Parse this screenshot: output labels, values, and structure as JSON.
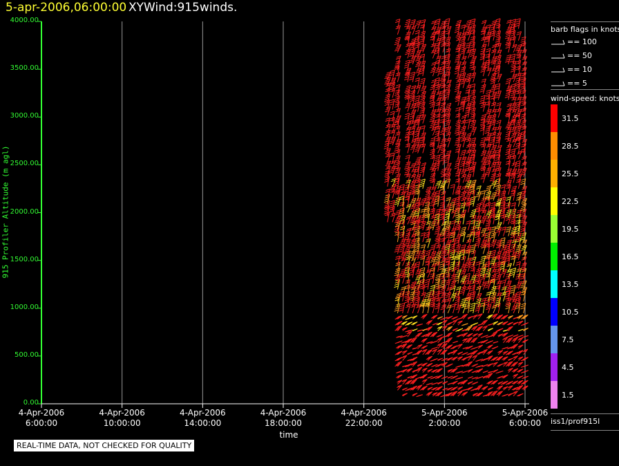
{
  "header": {
    "datetime": "5-apr-2006,06:00:00",
    "plot_name": "XYWind:915winds."
  },
  "chart_data": {
    "type": "scatter",
    "subtype": "wind-barbs",
    "xlabel": "time",
    "ylabel": "915 Profiler Altitude (m agl)",
    "ylim": [
      0,
      4000
    ],
    "x_ticks": [
      {
        "line1": "4-Apr-2006",
        "line2": "6:00:00"
      },
      {
        "line1": "4-Apr-2006",
        "line2": "10:00:00"
      },
      {
        "line1": "4-Apr-2006",
        "line2": "14:00:00"
      },
      {
        "line1": "4-Apr-2006",
        "line2": "18:00:00"
      },
      {
        "line1": "4-Apr-2006",
        "line2": "22:00:00"
      },
      {
        "line1": "5-Apr-2006",
        "line2": "2:00:00"
      },
      {
        "line1": "5-Apr-2006",
        "line2": "6:00:00"
      }
    ],
    "y_ticks": [
      "0.00",
      "500.00",
      "1000.00",
      "1500.00",
      "2000.00",
      "2500.00",
      "3000.00",
      "3500.00",
      "4000.00"
    ],
    "y_tick_values": [
      0,
      500,
      1000,
      1500,
      2000,
      2500,
      3000,
      3500,
      4000
    ],
    "x_hours_since_first_tick": [
      0,
      4,
      8,
      12,
      16,
      20,
      24
    ],
    "profile_times": [
      "4-Apr-2006 23:10",
      "4-Apr-2006 23:20",
      "4-Apr-2006 23:40",
      "4-Apr-2006 23:55",
      "5-Apr-2006 00:10",
      "5-Apr-2006 00:25",
      "5-Apr-2006 00:40",
      "5-Apr-2006 00:55",
      "5-Apr-2006 01:10",
      "5-Apr-2006 01:25",
      "5-Apr-2006 01:40",
      "5-Apr-2006 01:55",
      "5-Apr-2006 02:10",
      "5-Apr-2006 02:25",
      "5-Apr-2006 02:40",
      "5-Apr-2006 02:55",
      "5-Apr-2006 03:10",
      "5-Apr-2006 03:25",
      "5-Apr-2006 03:40",
      "5-Apr-2006 03:55",
      "5-Apr-2006 04:10",
      "5-Apr-2006 04:25",
      "5-Apr-2006 04:40",
      "5-Apr-2006 04:55",
      "5-Apr-2006 05:10",
      "5-Apr-2006 05:25",
      "5-Apr-2006 05:40",
      "5-Apr-2006 05:55"
    ],
    "colorbar": {
      "title": "wind-speed: knots",
      "levels": [
        "31.5",
        "28.5",
        "25.5",
        "22.5",
        "19.5",
        "16.5",
        "13.5",
        "10.5",
        "7.5",
        "4.5",
        "1.5"
      ],
      "colors": [
        "#ff0000",
        "#ff8c00",
        "#ffb000",
        "#ffff00",
        "#9aff33",
        "#00ee00",
        "#00ffff",
        "#0000ff",
        "#6495ed",
        "#a020f0",
        "#ee82ee"
      ]
    },
    "barb_legend": {
      "title": "barb flags in knots",
      "items": [
        "== 100",
        "== 50",
        "== 10",
        "== 5"
      ]
    },
    "series_colors": {
      "strong": "#ff2020",
      "moderate": "#ff9a20",
      "light": "#ffe020"
    }
  },
  "notice": "REAL-TIME DATA, NOT CHECKED FOR QUALITY",
  "source": "iss1/prof915l",
  "axis_color": "#33ff33"
}
